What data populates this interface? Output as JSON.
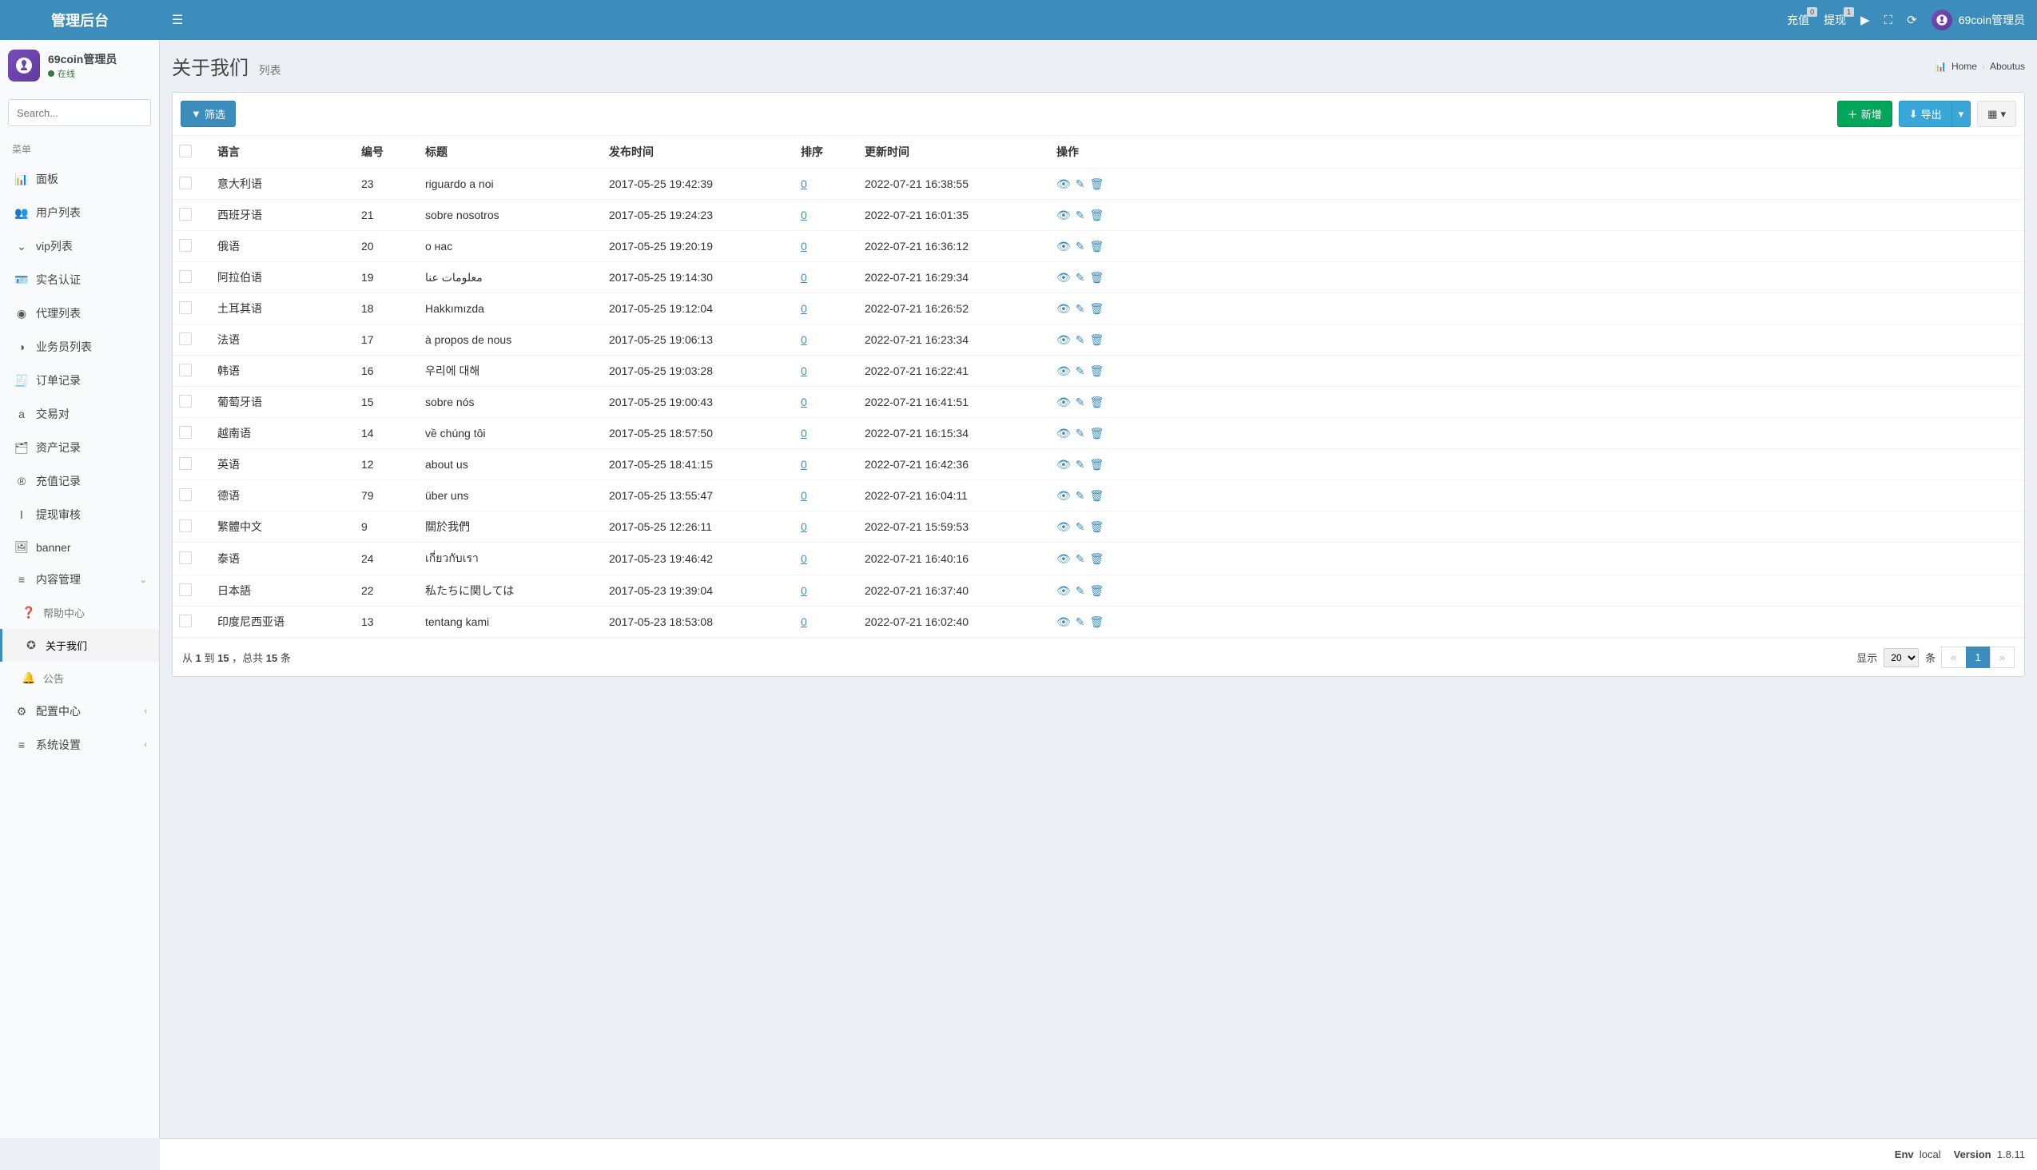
{
  "brand": "管理后台",
  "top": {
    "recharge": "充值",
    "recharge_badge": "0",
    "withdraw": "提现",
    "withdraw_badge": "1",
    "username": "69coin管理员"
  },
  "user_panel": {
    "name": "69coin管理员",
    "status": "在线"
  },
  "search_placeholder": "Search...",
  "menu_header": "菜单",
  "menu": [
    {
      "icon": "📊",
      "label": "面板"
    },
    {
      "icon": "👥",
      "label": "用户列表"
    },
    {
      "icon": "⌄",
      "label": "vip列表"
    },
    {
      "icon": "🪪",
      "label": "实名认证"
    },
    {
      "icon": "◉",
      "label": "代理列表"
    },
    {
      "icon": "◑",
      "label": "业务员列表"
    },
    {
      "icon": "🧾",
      "label": "订单记录"
    },
    {
      "icon": "a",
      "label": "交易对"
    },
    {
      "icon": "🗂",
      "label": "资产记录"
    },
    {
      "icon": "®",
      "label": "充值记录"
    },
    {
      "icon": "Ⅰ",
      "label": "提现审核"
    },
    {
      "icon": "🖼",
      "label": "banner"
    }
  ],
  "content_menu": {
    "icon": "≡",
    "label": "内容管理",
    "children": [
      {
        "icon": "❓",
        "label": "帮助中心"
      },
      {
        "icon": "✪",
        "label": "关于我们",
        "active": true
      },
      {
        "icon": "🔔",
        "label": "公告"
      }
    ]
  },
  "bottom_menu": [
    {
      "icon": "⚙",
      "label": "配置中心"
    },
    {
      "icon": "≡",
      "label": "系统设置"
    }
  ],
  "page": {
    "title": "关于我们",
    "subtitle": "列表"
  },
  "breadcrumb": {
    "home": "Home",
    "current": "Aboutus"
  },
  "toolbar": {
    "filter": "筛选",
    "add": "新增",
    "export": "导出"
  },
  "columns": {
    "lang": "语言",
    "id": "编号",
    "title": "标题",
    "publish": "发布时间",
    "sort": "排序",
    "update": "更新时间",
    "ops": "操作"
  },
  "rows": [
    {
      "lang": "意大利语",
      "id": "23",
      "title": "riguardo a noi",
      "publish": "2017-05-25 19:42:39",
      "sort": "0",
      "update": "2022-07-21 16:38:55"
    },
    {
      "lang": "西班牙语",
      "id": "21",
      "title": "sobre nosotros",
      "publish": "2017-05-25 19:24:23",
      "sort": "0",
      "update": "2022-07-21 16:01:35"
    },
    {
      "lang": "俄语",
      "id": "20",
      "title": "о нас",
      "publish": "2017-05-25 19:20:19",
      "sort": "0",
      "update": "2022-07-21 16:36:12"
    },
    {
      "lang": "阿拉伯语",
      "id": "19",
      "title": "معلومات عنا",
      "publish": "2017-05-25 19:14:30",
      "sort": "0",
      "update": "2022-07-21 16:29:34"
    },
    {
      "lang": "土耳其语",
      "id": "18",
      "title": "Hakkımızda",
      "publish": "2017-05-25 19:12:04",
      "sort": "0",
      "update": "2022-07-21 16:26:52"
    },
    {
      "lang": "法语",
      "id": "17",
      "title": "à propos de nous",
      "publish": "2017-05-25 19:06:13",
      "sort": "0",
      "update": "2022-07-21 16:23:34"
    },
    {
      "lang": "韩语",
      "id": "16",
      "title": "우리에 대해",
      "publish": "2017-05-25 19:03:28",
      "sort": "0",
      "update": "2022-07-21 16:22:41"
    },
    {
      "lang": "葡萄牙语",
      "id": "15",
      "title": "sobre nós",
      "publish": "2017-05-25 19:00:43",
      "sort": "0",
      "update": "2022-07-21 16:41:51"
    },
    {
      "lang": "越南语",
      "id": "14",
      "title": "về chúng tôi",
      "publish": "2017-05-25 18:57:50",
      "sort": "0",
      "update": "2022-07-21 16:15:34"
    },
    {
      "lang": "英语",
      "id": "12",
      "title": "about us",
      "publish": "2017-05-25 18:41:15",
      "sort": "0",
      "update": "2022-07-21 16:42:36"
    },
    {
      "lang": "德语",
      "id": "79",
      "title": "über uns",
      "publish": "2017-05-25 13:55:47",
      "sort": "0",
      "update": "2022-07-21 16:04:11"
    },
    {
      "lang": "繁體中文",
      "id": "9",
      "title": "關於我們",
      "publish": "2017-05-25 12:26:11",
      "sort": "0",
      "update": "2022-07-21 15:59:53"
    },
    {
      "lang": "泰语",
      "id": "24",
      "title": "เกี่ยวกับเรา",
      "publish": "2017-05-23 19:46:42",
      "sort": "0",
      "update": "2022-07-21 16:40:16"
    },
    {
      "lang": "日本語",
      "id": "22",
      "title": "私たちに関しては",
      "publish": "2017-05-23 19:39:04",
      "sort": "0",
      "update": "2022-07-21 16:37:40"
    },
    {
      "lang": "印度尼西亚语",
      "id": "13",
      "title": "tentang kami",
      "publish": "2017-05-23 18:53:08",
      "sort": "0",
      "update": "2022-07-21 16:02:40"
    }
  ],
  "pagination": {
    "info_prefix": "从 ",
    "from": "1",
    "info_mid": " 到 ",
    "to": "15",
    "info_sep": " ，总共 ",
    "total": "15",
    "info_suffix": " 条",
    "show_label": "显示",
    "per_page": "20",
    "unit": "条",
    "current": "1"
  },
  "footer": {
    "env_label": "Env",
    "env_value": "local",
    "version_label": "Version",
    "version_value": "1.8.11"
  }
}
